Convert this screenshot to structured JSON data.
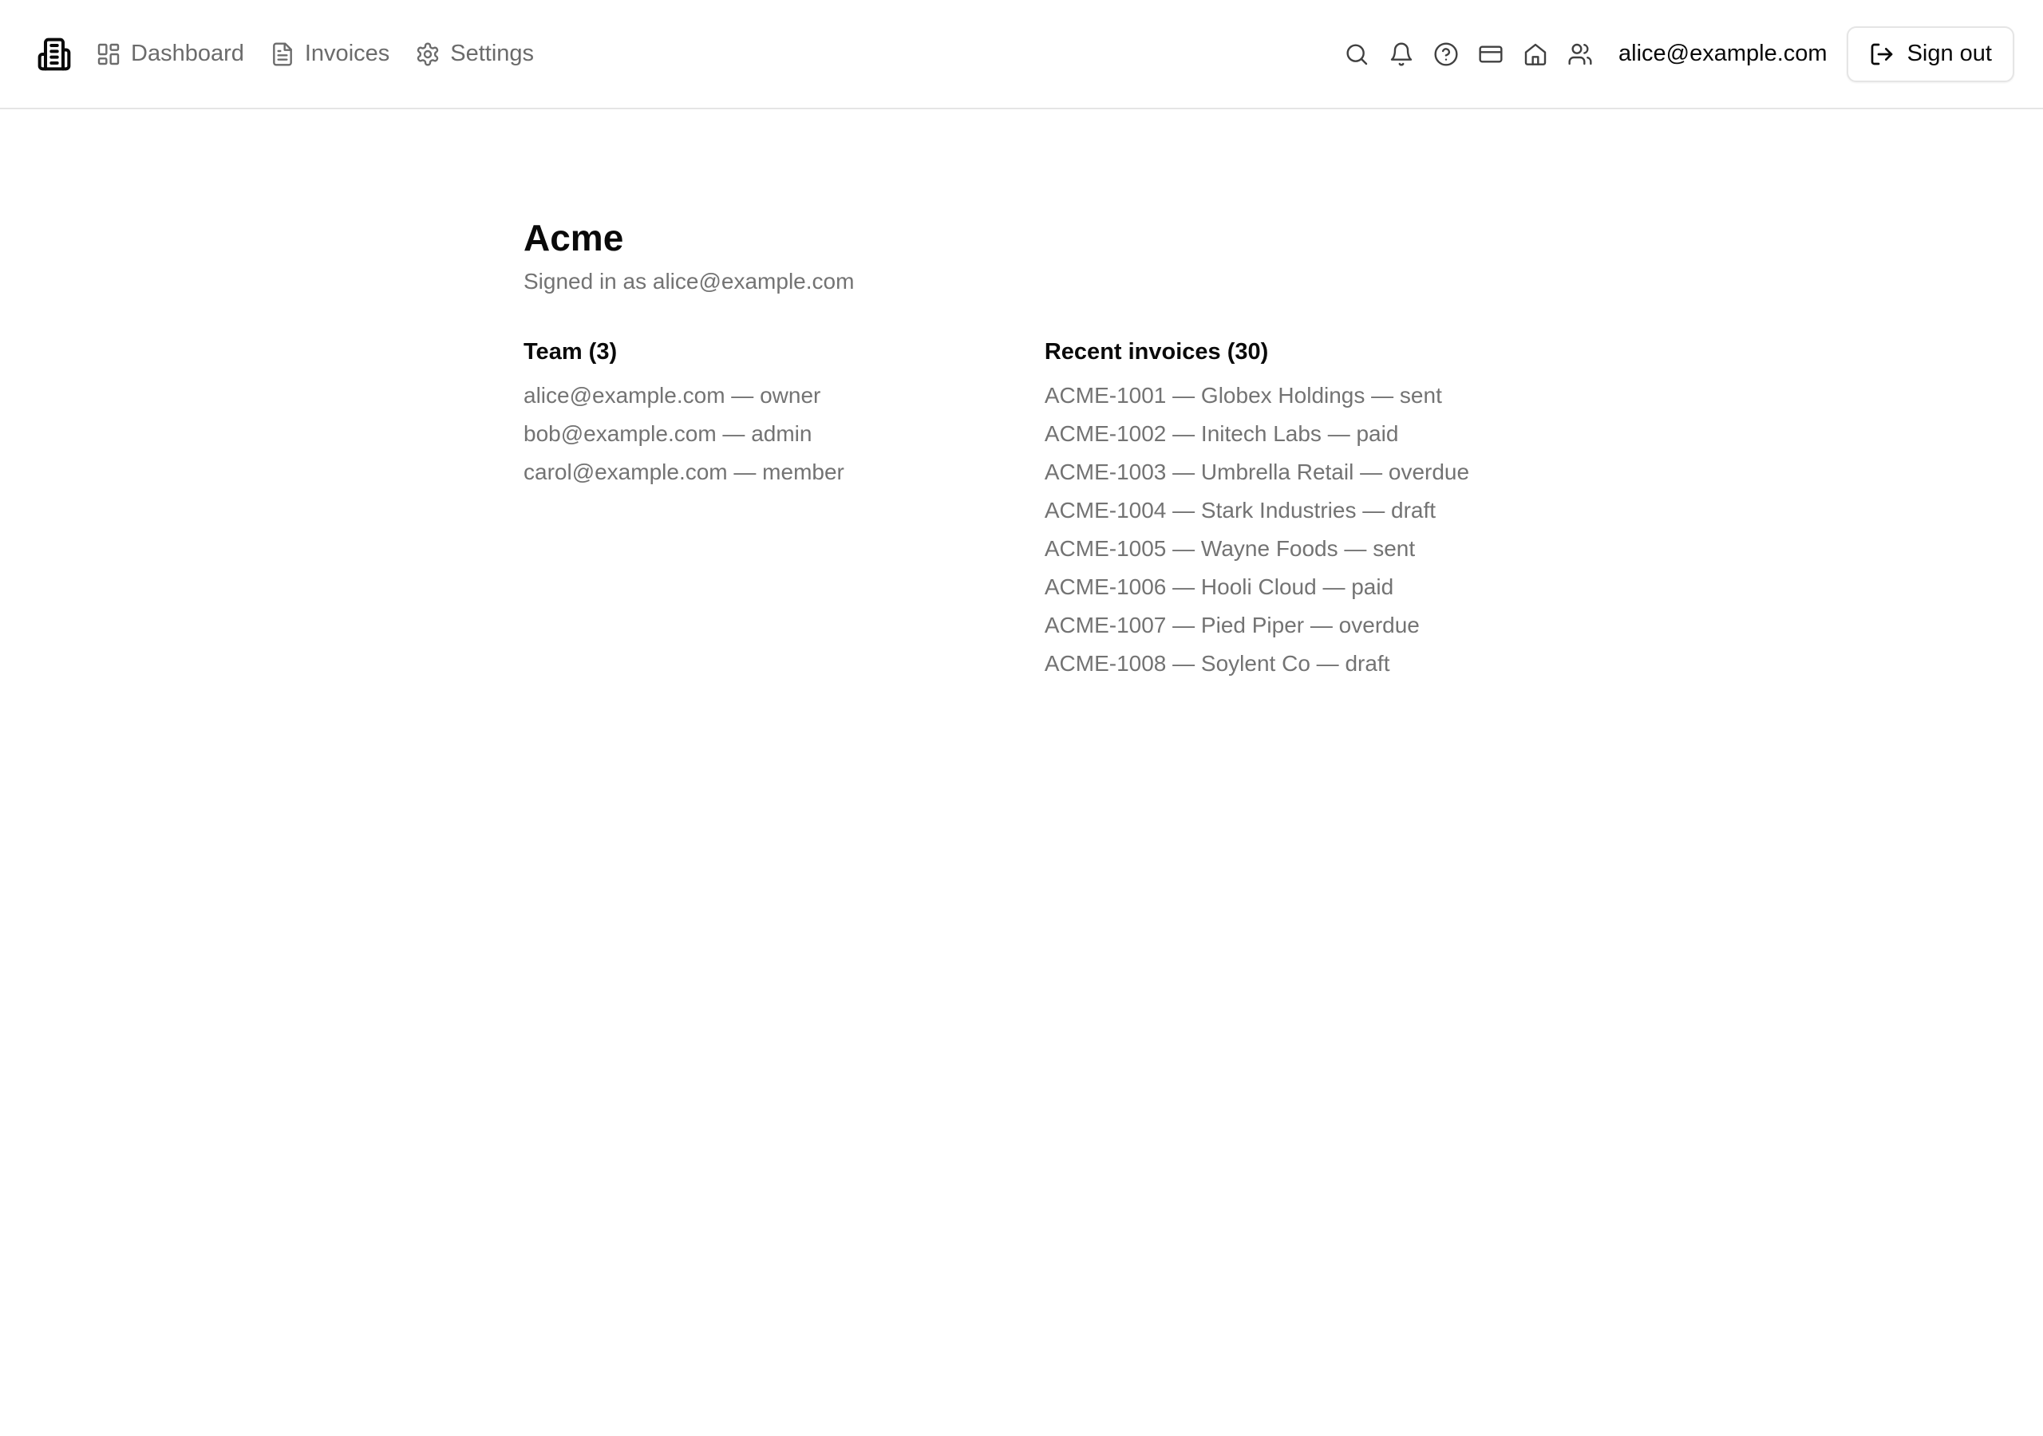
{
  "nav": {
    "logo_icon": "building-icon",
    "links": [
      {
        "label": "Dashboard",
        "icon": "layout-dashboard-icon"
      },
      {
        "label": "Invoices",
        "icon": "file-text-icon"
      },
      {
        "label": "Settings",
        "icon": "gear-icon"
      }
    ],
    "icons": [
      "search-icon",
      "bell-icon",
      "help-circle-icon",
      "credit-card-icon",
      "home-icon",
      "users-icon"
    ],
    "user_email": "alice@example.com",
    "sign_out_label": "Sign out",
    "sign_out_icon": "log-out-icon"
  },
  "page": {
    "title": "Acme",
    "subtitle": "Signed in as alice@example.com"
  },
  "team": {
    "heading": "Team (3)",
    "members": [
      "alice@example.com — owner",
      "bob@example.com — admin",
      "carol@example.com — member"
    ]
  },
  "invoices": {
    "heading": "Recent invoices (30)",
    "items": [
      "ACME-1001 — Globex Holdings — sent",
      "ACME-1002 — Initech Labs — paid",
      "ACME-1003 — Umbrella Retail — overdue",
      "ACME-1004 — Stark Industries — draft",
      "ACME-1005 — Wayne Foods — sent",
      "ACME-1006 — Hooli Cloud — paid",
      "ACME-1007 — Pied Piper — overdue",
      "ACME-1008 — Soylent Co — draft"
    ]
  },
  "colors": {
    "text": "#0a0a0a",
    "muted": "#737373",
    "nav_muted": "#6b6b6b",
    "border": "#e5e5e5",
    "background": "#ffffff"
  }
}
